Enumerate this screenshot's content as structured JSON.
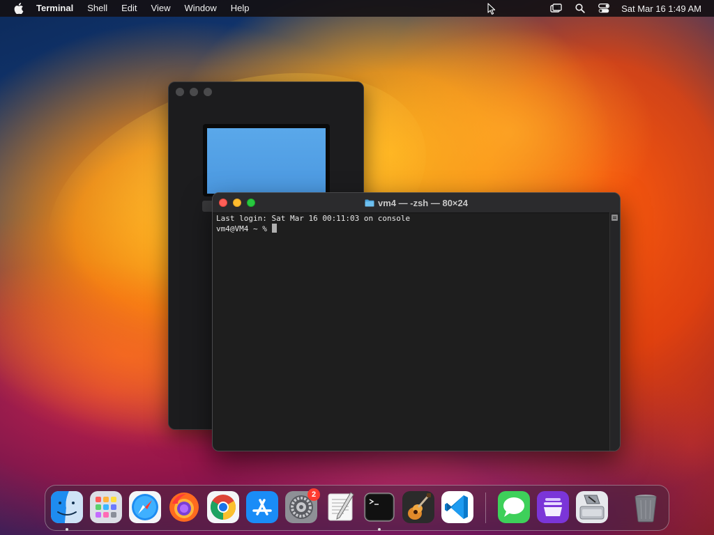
{
  "menubar": {
    "app_name": "Terminal",
    "menus": [
      "Shell",
      "Edit",
      "View",
      "Window",
      "Help"
    ],
    "clock": "Sat Mar 16  1:49 AM"
  },
  "terminal": {
    "title": "vm4 — -zsh — 80×24",
    "lines": [
      "Last login: Sat Mar 16 00:11:03 on console",
      "vm4@VM4 ~ % "
    ]
  },
  "dock": {
    "apps": [
      {
        "name": "finder-icon",
        "running": true
      },
      {
        "name": "launchpad-icon",
        "running": false
      },
      {
        "name": "safari-icon",
        "running": false
      },
      {
        "name": "firefox-icon",
        "running": false
      },
      {
        "name": "chrome-icon",
        "running": false
      },
      {
        "name": "app-store-icon",
        "running": false
      },
      {
        "name": "system-settings-icon",
        "running": false,
        "badge": "2"
      },
      {
        "name": "textedit-icon",
        "running": false
      },
      {
        "name": "terminal-icon",
        "running": true
      },
      {
        "name": "garageband-icon",
        "running": false
      },
      {
        "name": "vscode-icon",
        "running": false
      },
      {
        "name": "messages-icon",
        "running": false
      },
      {
        "name": "podcasts-icon",
        "running": false
      },
      {
        "name": "disk-utility-icon",
        "running": false
      },
      {
        "name": "trash-icon",
        "running": false
      }
    ]
  },
  "colors": {
    "close": "#ff5f57",
    "minimize": "#febc2e",
    "maximize": "#28c840",
    "badge": "#ff3b30",
    "terminal_bg": "#1e1e1e"
  }
}
